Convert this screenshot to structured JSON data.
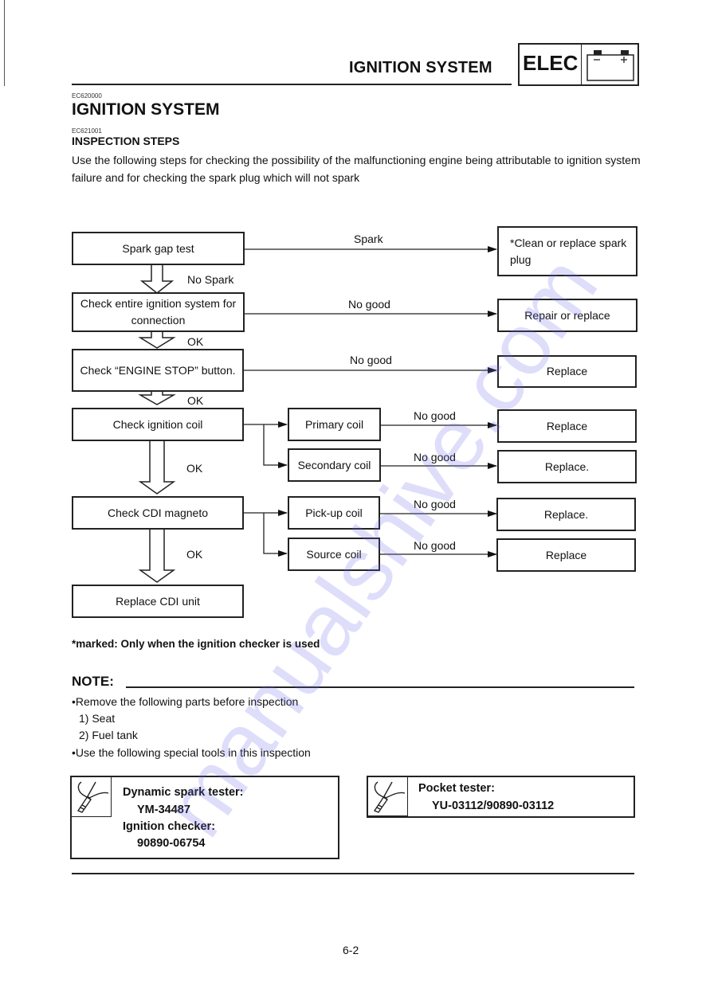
{
  "header": {
    "section_title": "IGNITION SYSTEM",
    "badge_label": "ELEC",
    "badge_icon": "battery-icon"
  },
  "section": {
    "code1": "EC620000",
    "title": "IGNITION SYSTEM",
    "code2": "EC621001",
    "subtitle": "INSPECTION STEPS",
    "intro": "Use the following steps for checking the possibility of the malfunctioning engine being attributable to ignition system failure and for checking the spark plug which will not spark"
  },
  "flowchart": {
    "steps": [
      {
        "label": "Spark gap test",
        "branch_label": "Spark",
        "result": "*Clean or replace spark plug",
        "next_label": "No Spark"
      },
      {
        "label": "Check entire ignition system for connection",
        "branch_label": "No good",
        "result": "Repair or replace",
        "next_label": "OK"
      },
      {
        "label": "Check “ENGINE STOP” button.",
        "branch_label": "No good",
        "result": "Replace",
        "next_label": "OK"
      },
      {
        "label": "Check ignition coil",
        "next_label": "OK",
        "subchecks": [
          {
            "label": "Primary coil",
            "branch_label": "No good",
            "result": "Replace"
          },
          {
            "label": "Secondary coil",
            "branch_label": "No good",
            "result": "Replace."
          }
        ]
      },
      {
        "label": "Check CDI magneto",
        "next_label": "OK",
        "subchecks": [
          {
            "label": "Pick-up coil",
            "branch_label": "No good",
            "result": "Replace."
          },
          {
            "label": "Source coil",
            "branch_label": "No good",
            "result": "Replace"
          }
        ]
      },
      {
        "label": "Replace CDI unit"
      }
    ]
  },
  "footnote": "*marked: Only when the ignition checker is used",
  "note": {
    "title": "NOTE:",
    "lines": [
      "•Remove the following parts before inspection",
      "1)  Seat",
      "2)  Fuel tank",
      "•Use the following special tools in this inspection"
    ]
  },
  "tools": [
    {
      "icon": "special-tool-icon",
      "items": [
        {
          "name": "Dynamic spark tester:",
          "number": "YM-34487"
        },
        {
          "name": "Ignition checker:",
          "number": "90890-06754"
        }
      ]
    },
    {
      "icon": "special-tool-icon",
      "items": [
        {
          "name": "Pocket tester:",
          "number": "YU-03112/90890-03112"
        }
      ]
    }
  ],
  "page_number": "6-2",
  "watermark": "manualshive.com"
}
